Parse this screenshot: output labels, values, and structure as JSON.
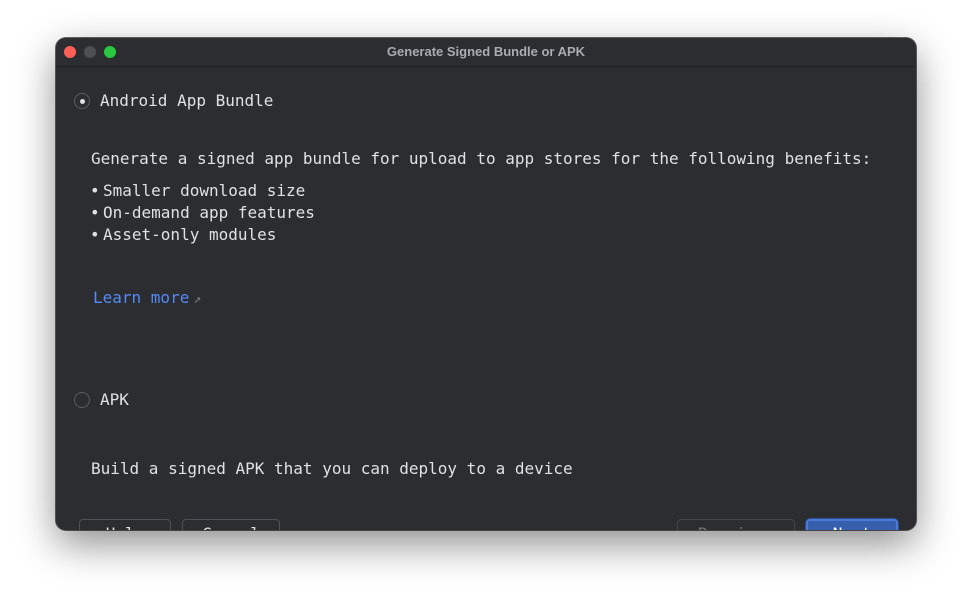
{
  "window": {
    "title": "Generate Signed Bundle or APK"
  },
  "options": {
    "bundle": {
      "label": "Android App Bundle",
      "selected": true,
      "description": "Generate a signed app bundle for upload to app stores for the following benefits:",
      "benefits": [
        "Smaller download size",
        "On-demand app features",
        "Asset-only modules"
      ],
      "learn_more": "Learn more",
      "learn_more_icon": "external-link-arrow-icon"
    },
    "apk": {
      "label": "APK",
      "selected": false,
      "description": "Build a signed APK that you can deploy to a device"
    }
  },
  "buttons": {
    "help": "Help",
    "cancel": "Cancel",
    "previous": "Previous",
    "next": "Next"
  },
  "colors": {
    "background": "#2b2d30",
    "link": "#548af7",
    "primary_button": "#375fad"
  }
}
